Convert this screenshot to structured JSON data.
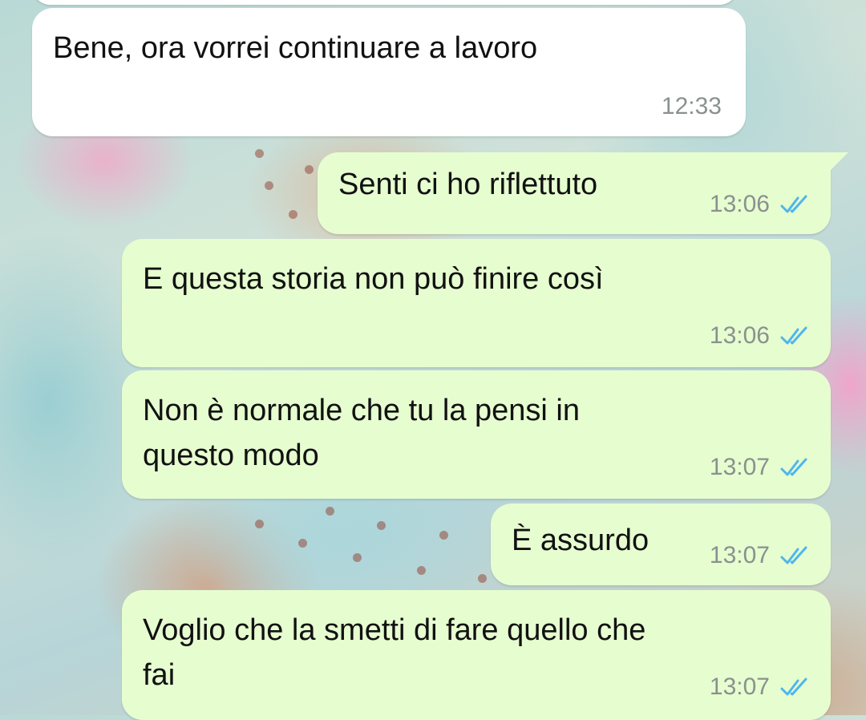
{
  "chat": {
    "messages": [
      {
        "direction": "incoming",
        "text": "Bene, ora vorrei continuare a lavoro",
        "time": "12:33"
      },
      {
        "direction": "outgoing",
        "text": "Senti ci ho riflettuto",
        "time": "13:06",
        "status": "read"
      },
      {
        "direction": "outgoing",
        "text": "E questa storia non può finire così",
        "time": "13:06",
        "status": "read"
      },
      {
        "direction": "outgoing",
        "lines": [
          "Non è normale che tu la pensi in",
          "questo modo"
        ],
        "time": "13:07",
        "status": "read"
      },
      {
        "direction": "outgoing",
        "text": "È assurdo",
        "time": "13:07",
        "status": "read"
      },
      {
        "direction": "outgoing",
        "lines": [
          "Voglio che la smetti di fare quello che",
          "fai"
        ],
        "time": "13:07",
        "status": "read"
      }
    ]
  },
  "icons": {
    "read_receipt": "double-check-icon"
  },
  "colors": {
    "incoming_bubble": "#ffffff",
    "outgoing_bubble": "#e6fdd0",
    "read_receipt": "#4fb6ec",
    "timestamp": "#8a918e"
  }
}
